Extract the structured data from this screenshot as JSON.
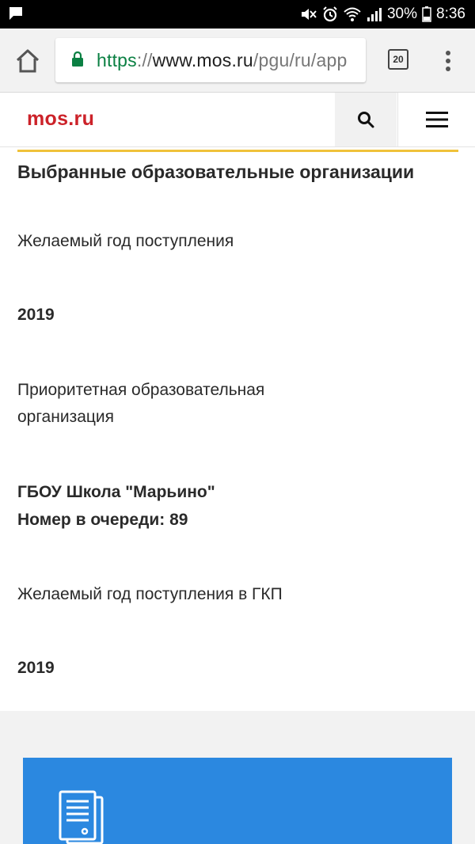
{
  "status_bar": {
    "battery_percent": "30%",
    "time": "8:36",
    "icons": [
      "notification-icon",
      "mute-icon",
      "alarm-icon",
      "wifi-icon",
      "signal-icon",
      "battery-icon"
    ]
  },
  "browser": {
    "url_scheme": "https",
    "url_sep": "://",
    "url_host": "www.mos.ru",
    "url_path": "/pgu/ru/app",
    "tab_count": "20",
    "colors": {
      "secure": "#0b8043"
    }
  },
  "site": {
    "logo": "mos.ru",
    "colors": {
      "logo": "#cc2229",
      "accent": "#f0c23a",
      "card": "#2b88e0"
    }
  },
  "main": {
    "section_title": "Выбранные образовательные организации",
    "year_label": "Желаемый год поступления",
    "year_value": "2019",
    "priority_label": "Приоритетная образовательная организация",
    "school_name": "ГБОУ Школа \"Марьино\"",
    "queue_number": "Номер в очереди: 89",
    "gkp_label": "Желаемый год поступления в ГКП",
    "gkp_value": "2019"
  }
}
